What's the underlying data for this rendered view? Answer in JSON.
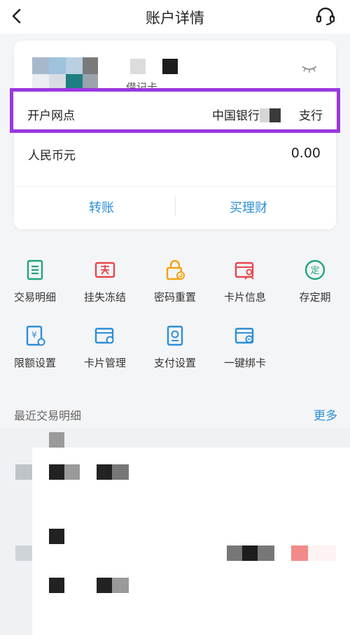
{
  "header": {
    "title": "账户详情",
    "back_icon": "chevron-left-icon",
    "service_icon": "headset-icon"
  },
  "account": {
    "card_type": "借记卡",
    "branch_label": "开户网点",
    "branch_prefix": "中国银行",
    "branch_suffix": "支行",
    "currency": "人民币元",
    "balance": "0.00",
    "eye_icon": "eye-closed-icon"
  },
  "actions": {
    "transfer": "转账",
    "wealth": "买理财"
  },
  "services": [
    {
      "label": "交易明细",
      "icon": "transaction-list-icon",
      "color": "#1fa67a"
    },
    {
      "label": "挂失冻结",
      "icon": "report-loss-icon",
      "color": "#e5484d"
    },
    {
      "label": "密码重置",
      "icon": "lock-reset-icon",
      "color": "#f2a30f"
    },
    {
      "label": "卡片信息",
      "icon": "card-user-icon",
      "color": "#e5484d"
    },
    {
      "label": "存定期",
      "icon": "fixed-deposit-icon",
      "color": "#1fa67a"
    },
    {
      "label": "限额设置",
      "icon": "limit-settings-icon",
      "color": "#2d8ed6"
    },
    {
      "label": "卡片管理",
      "icon": "card-settings-icon",
      "color": "#2d8ed6"
    },
    {
      "label": "支付设置",
      "icon": "payment-settings-icon",
      "color": "#2d8ed6"
    },
    {
      "label": "一键绑卡",
      "icon": "bind-card-icon",
      "color": "#2d8ed6"
    }
  ],
  "recent": {
    "title": "最近交易明细",
    "more": "更多"
  },
  "colors": {
    "accent_blue": "#2d8ed6",
    "highlight_purple": "#9b37e0"
  }
}
